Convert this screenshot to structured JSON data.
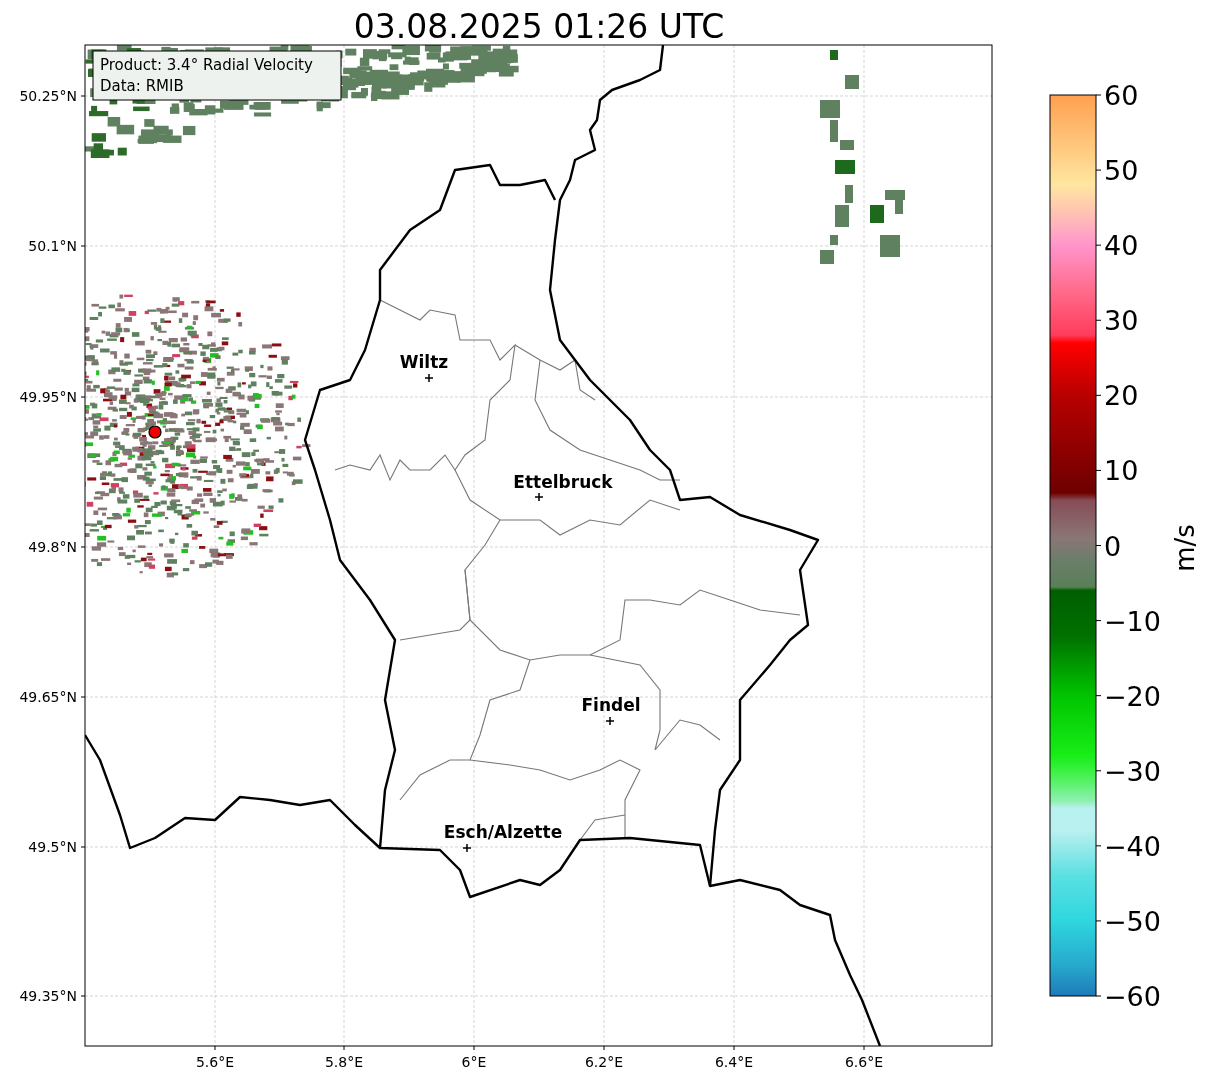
{
  "title": "03.08.2025 01:26 UTC",
  "info_box": [
    "Product: 3.4° Radial Velocity",
    "Data: RMIB"
  ],
  "map": {
    "lat_ticks": [
      "50.25°N",
      "50.1°N",
      "49.95°N",
      "49.8°N",
      "49.65°N",
      "49.5°N",
      "49.35°N"
    ],
    "lon_ticks": [
      "5.6°E",
      "5.8°E",
      "6°E",
      "6.2°E",
      "6.4°E",
      "6.6°E"
    ],
    "cities": [
      {
        "label": "Wiltz"
      },
      {
        "label": "Ettelbruck"
      },
      {
        "label": "Findel"
      },
      {
        "label": "Esch/Alzette"
      }
    ]
  },
  "colorbar": {
    "ticks": [
      "60",
      "50",
      "40",
      "30",
      "20",
      "10",
      "0",
      "−10",
      "−20",
      "−30",
      "−40",
      "−50",
      "−60"
    ],
    "label": "m/s"
  }
}
